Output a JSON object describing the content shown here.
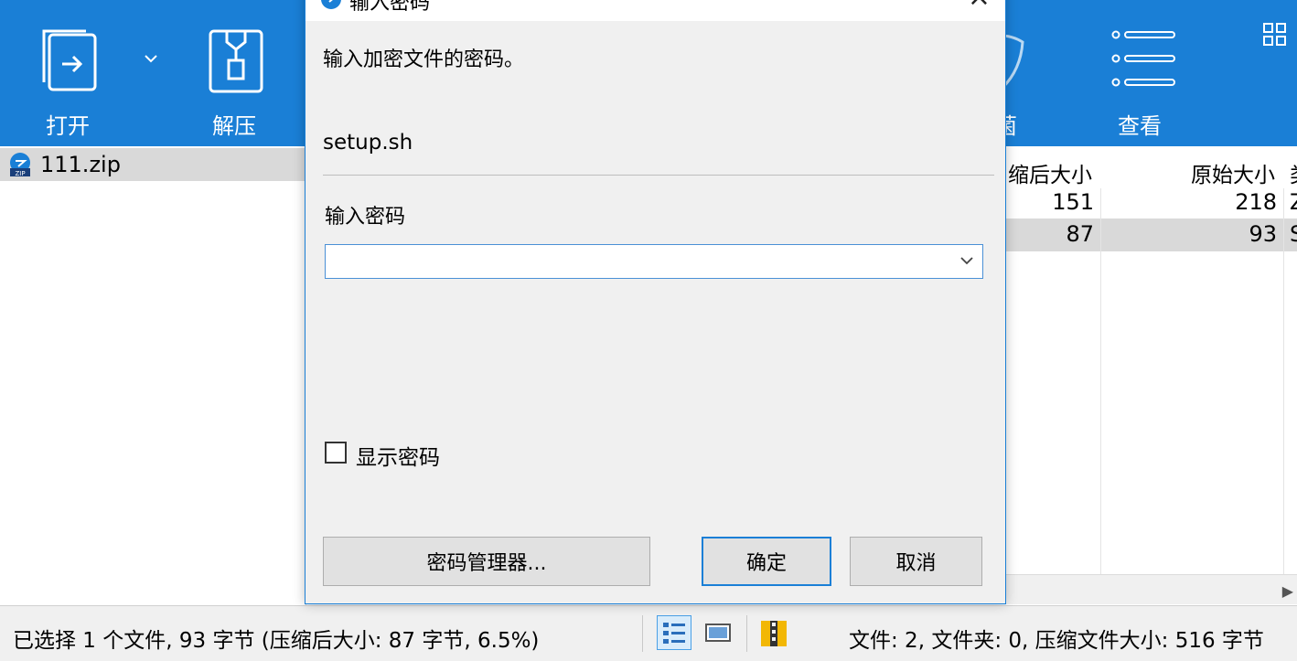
{
  "toolbar": {
    "open_label": "打开",
    "extract_label": "解压",
    "partial_label": "菌",
    "view_label": "查看"
  },
  "left_panel": {
    "items": [
      {
        "name": "111.zip"
      }
    ]
  },
  "right_panel": {
    "headers": {
      "compressed": "缩后大小",
      "original": "原始大小",
      "type": "类"
    },
    "rows": [
      {
        "compressed": "151",
        "original": "218",
        "type": "Z"
      },
      {
        "compressed": "87",
        "original": "93",
        "type": "S"
      }
    ]
  },
  "dialog": {
    "title": "输入密码",
    "prompt": "输入加密文件的密码。",
    "filename": "setup.sh",
    "password_label": "输入密码",
    "password_value": "",
    "show_password_label": "显示密码",
    "show_password_checked": false,
    "password_manager_button": "密码管理器...",
    "ok_button": "确定",
    "cancel_button": "取消"
  },
  "statusbar": {
    "selection_text": "已选择 1 个文件, 93 字节 (压缩后大小: 87 字节, 6.5%)",
    "summary_text": "文件: 2, 文件夹: 0, 压缩文件大小: 516 字节"
  },
  "colors": {
    "accent": "#1a7fd6",
    "toolbar_bg": "#1a7fd6",
    "selected_row": "#d9d9d9"
  }
}
